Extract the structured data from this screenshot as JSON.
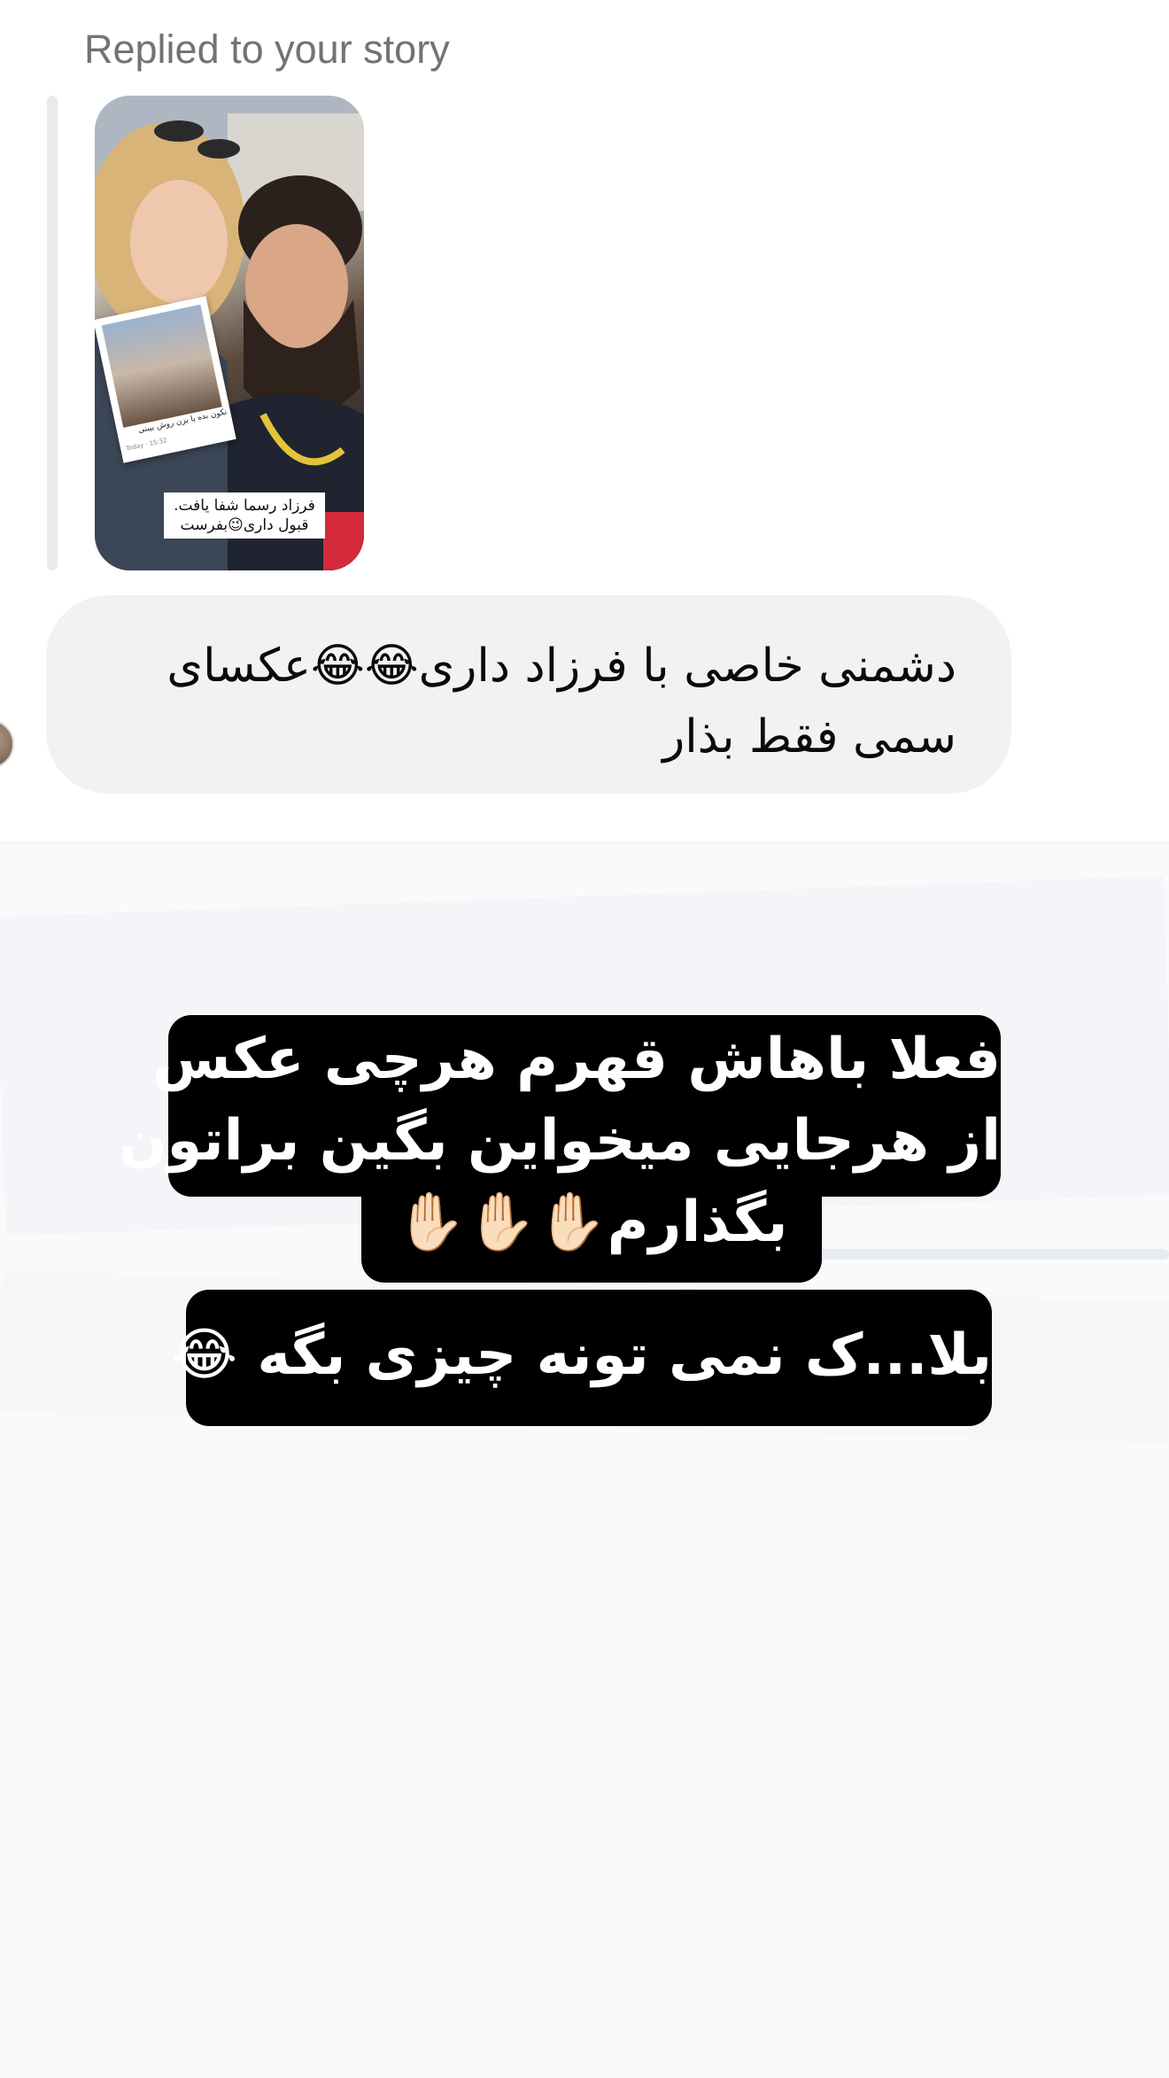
{
  "reply_header": {
    "label": "Replied to your story"
  },
  "story_preview": {
    "polaroid_caption": "نکون بده یا بزن روش بیبنی",
    "polaroid_time": "Today · 15:32",
    "caption_line_1": "فرزاد رسما شفا یافت.",
    "caption_line_2": "قبول داری😉بفرست"
  },
  "message": {
    "text": "دشمنی خاصی با فرزاد داری😂😂عکسای سمی فقط بذار"
  },
  "story_sticker": {
    "line_1": "فعلا باهاش قهرم هرچی عکس",
    "line_2": "از هرجایی میخواین بگین براتون",
    "line_3": "بگذارم✋🏻✋🏻✋🏻",
    "line_4": "بلا...ک نمی تونه چیزی بگه 😂"
  },
  "colors": {
    "bubble_bg": "#f1f2f4",
    "label_gray": "#737373",
    "sticker_bg": "#000000",
    "sticker_text": "#ffffff"
  }
}
